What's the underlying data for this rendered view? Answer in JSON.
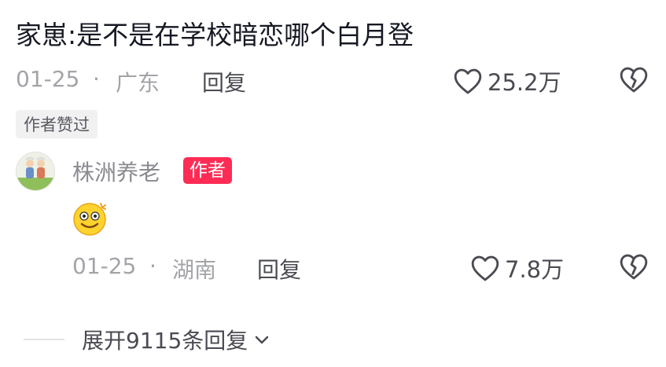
{
  "comment": {
    "text": "家崽:是不是在学校暗恋哪个白月登",
    "date": "01-25",
    "separator": "·",
    "location": "广东",
    "reply_label": "回复",
    "likes": "25.2万",
    "author_liked_badge": "作者赞过"
  },
  "reply": {
    "username": "株洲养老",
    "author_tag": "作者",
    "date": "01-25",
    "separator": "·",
    "location": "湖南",
    "reply_label": "回复",
    "likes": "7.8万"
  },
  "expand": {
    "label": "展开9115条回复"
  },
  "colors": {
    "author_tag_bg": "#fe2c55",
    "meta_text": "#a3a4a8"
  }
}
